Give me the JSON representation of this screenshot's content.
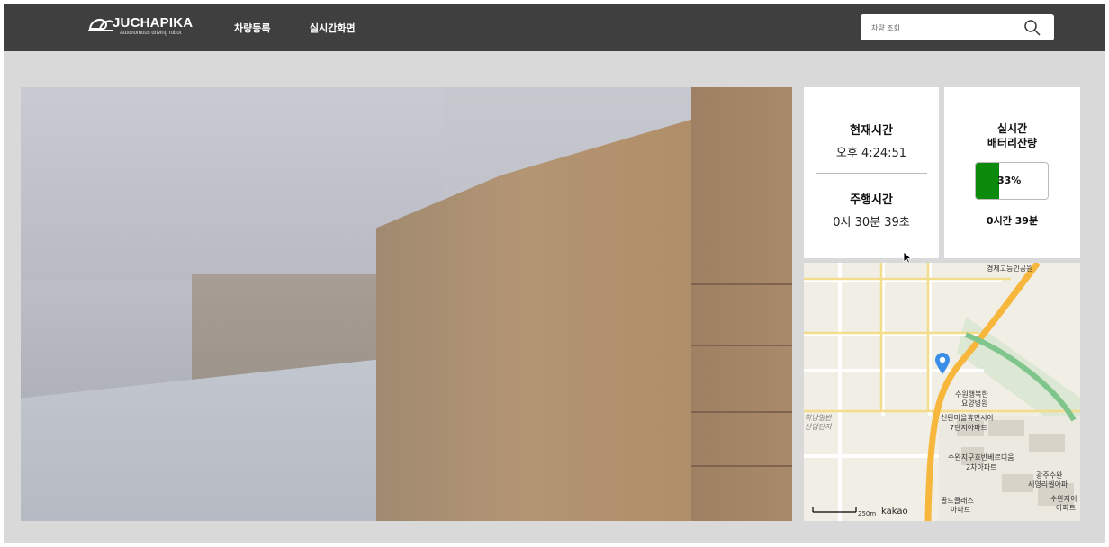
{
  "header": {
    "logo_title": "JUCHAPIKA",
    "logo_subtitle": "Autonomous driving robot",
    "nav": [
      "차량등록",
      "실시간화면"
    ],
    "search_placeholder": "차량 조회"
  },
  "time_card": {
    "current_time_label": "현재시간",
    "current_time_value": "오후 4:24:51",
    "drive_time_label": "주행시간",
    "drive_time_value": "0시 30분 39초"
  },
  "battery_card": {
    "label_line1": "실시간",
    "label_line2": "배터리잔량",
    "percent_text": "33%",
    "level": 0.33,
    "remaining": "0시간 39분",
    "fill_color": "#0b8a0b"
  },
  "map": {
    "labels": [
      "경제고등인공원",
      "수원행복한",
      "요양병원",
      "신완마을휴먼시아",
      "7단지아파트",
      "수완지구호반베르디움",
      "2차아파트",
      "광주수완",
      "세영리첼아파",
      "골드클래스",
      "아파트",
      "수완자이",
      "아파트",
      "하남일반",
      "산업단지"
    ],
    "scale_text": "250m",
    "brand": "kakao",
    "marker_color": "#3b8ee8"
  },
  "icons": {
    "search": "search-icon",
    "marker": "map-marker-icon",
    "cursor": "mouse-pointer-icon",
    "logo": "turtle-logo-icon"
  }
}
